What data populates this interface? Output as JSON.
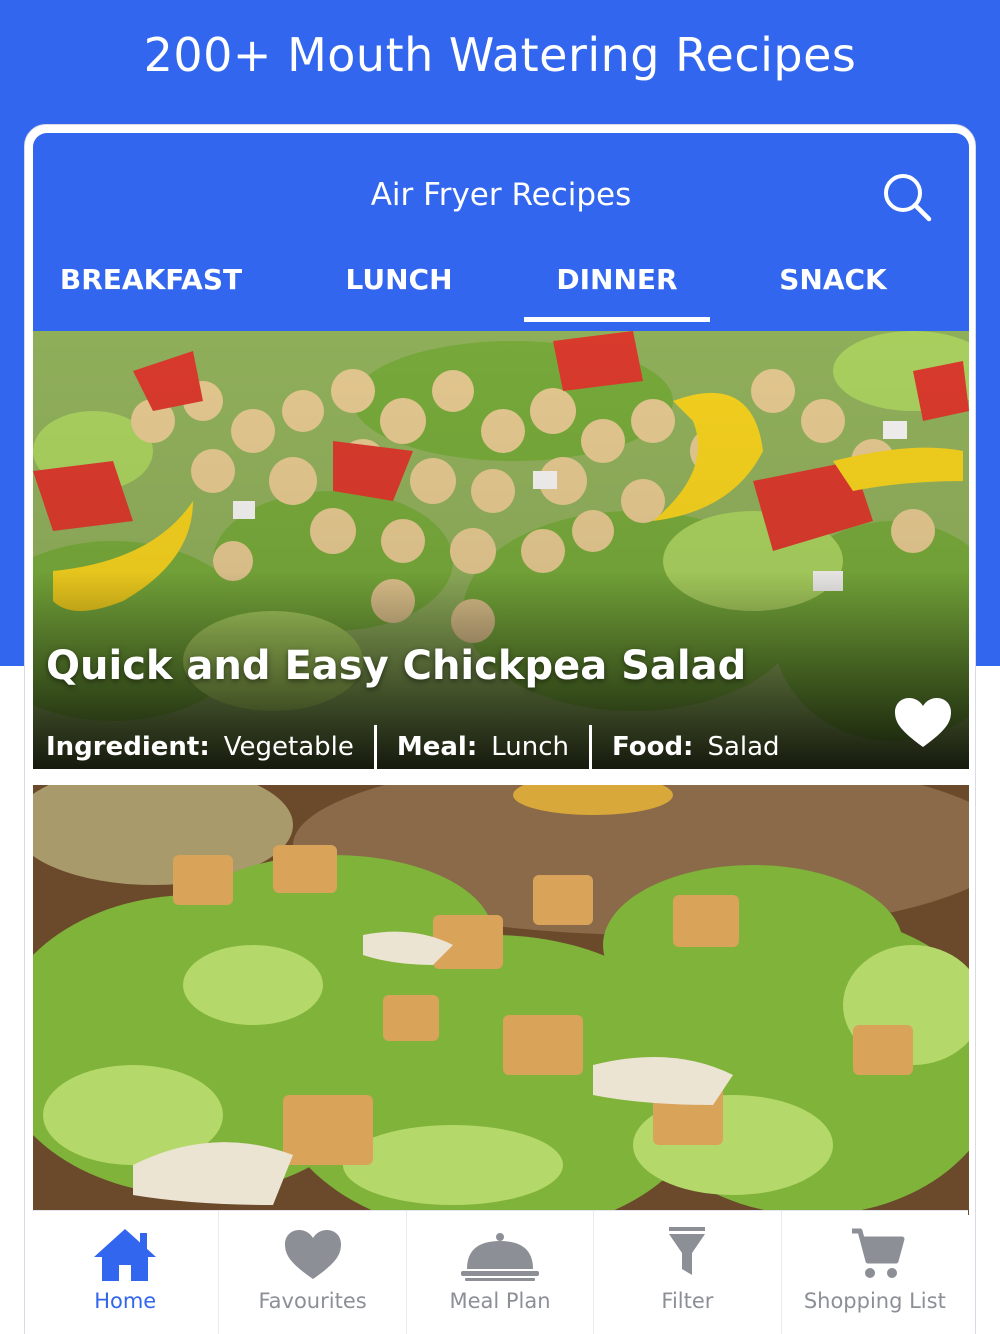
{
  "hero": {
    "title": "200+ Mouth Watering Recipes"
  },
  "app_bar": {
    "title": "Air Fryer Recipes",
    "search_icon": "search-icon"
  },
  "tabs": [
    {
      "label": "BREAKFAST",
      "active": false
    },
    {
      "label": "LUNCH",
      "active": false
    },
    {
      "label": "DINNER",
      "active": true
    },
    {
      "label": "SNACK",
      "active": false
    }
  ],
  "recipes": [
    {
      "title": "Quick and Easy Chickpea Salad",
      "ingredient_label": "Ingredient:",
      "ingredient": "Vegetable",
      "meal_label": "Meal:",
      "meal": "Lunch",
      "food_label": "Food:",
      "food": "Salad",
      "favourite_icon": "heart-icon"
    },
    {
      "title": ""
    }
  ],
  "bottom_nav": [
    {
      "label": "Home",
      "icon": "home-icon",
      "active": true
    },
    {
      "label": "Favourites",
      "icon": "heart-icon",
      "active": false
    },
    {
      "label": "Meal Plan",
      "icon": "cloche-icon",
      "active": false
    },
    {
      "label": "Filter",
      "icon": "filter-icon",
      "active": false
    },
    {
      "label": "Shopping List",
      "icon": "cart-icon",
      "active": false
    }
  ],
  "colors": {
    "brand_blue": "#3366ee",
    "inactive_gray": "#8c8f96",
    "white": "#ffffff"
  }
}
